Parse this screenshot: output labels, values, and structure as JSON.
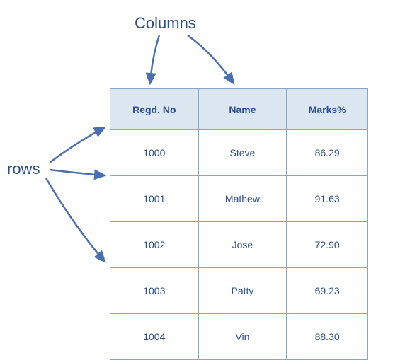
{
  "labels": {
    "columns": "Columns",
    "rows": "rows"
  },
  "table": {
    "headers": [
      "Regd. No",
      "Name",
      "Marks%"
    ],
    "rows": [
      {
        "regd": "1000",
        "name": "Steve",
        "marks": "86.29"
      },
      {
        "regd": "1001",
        "name": "Mathew",
        "marks": "91.63"
      },
      {
        "regd": "1002",
        "name": "Jose",
        "marks": "72.90"
      },
      {
        "regd": "1003",
        "name": "Patty",
        "marks": "69.23"
      },
      {
        "regd": "1004",
        "name": "Vin",
        "marks": "88.30"
      }
    ]
  },
  "chart_data": {
    "type": "table",
    "title": "",
    "columns": [
      "Regd. No",
      "Name",
      "Marks%"
    ],
    "data": [
      [
        1000,
        "Steve",
        86.29
      ],
      [
        1001,
        "Mathew",
        91.63
      ],
      [
        1002,
        "Jose",
        72.9
      ],
      [
        1003,
        "Patty",
        69.23
      ],
      [
        1004,
        "Vin",
        88.3
      ]
    ],
    "annotations": [
      "Columns",
      "rows"
    ]
  }
}
